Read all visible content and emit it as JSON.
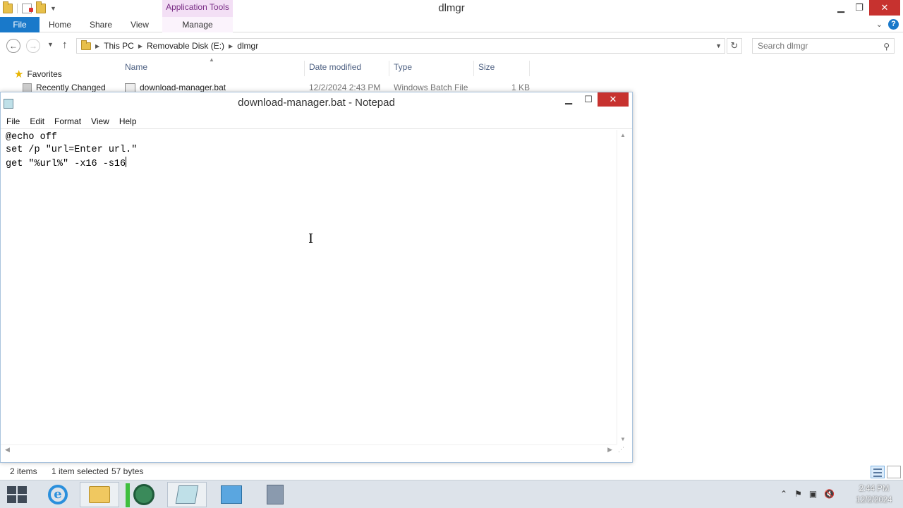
{
  "explorer": {
    "title": "dlmgr",
    "context_tab": "Application Tools",
    "ribbon_tabs": {
      "file": "File",
      "home": "Home",
      "share": "Share",
      "view": "View",
      "manage": "Manage"
    },
    "breadcrumb": [
      "This PC",
      "Removable Disk (E:)",
      "dlmgr"
    ],
    "search_placeholder": "Search dlmgr",
    "favorites_label": "Favorites",
    "recently_changed_label": "Recently Changed",
    "columns": {
      "name": "Name",
      "date_modified": "Date modified",
      "type": "Type",
      "size": "Size"
    },
    "file": {
      "name": "download-manager.bat",
      "date_modified": "12/2/2024 2:43 PM",
      "type": "Windows Batch File",
      "size": "1 KB"
    },
    "status": {
      "items": "2 items",
      "selected": "1 item selected",
      "bytes": "57 bytes"
    }
  },
  "notepad": {
    "title": "download-manager.bat - Notepad",
    "menu": {
      "file": "File",
      "edit": "Edit",
      "format": "Format",
      "view": "View",
      "help": "Help"
    },
    "lines": [
      "@echo off",
      "set /p \"url=Enter url.\"",
      "get \"%url%\" -x16 -s16"
    ]
  },
  "taskbar": {
    "time": "2:44 PM",
    "date": "12/2/2024"
  },
  "colors": {
    "file_tab": "#1979ca",
    "app_tools": "#7a2d86",
    "close_button": "#c7322f"
  }
}
